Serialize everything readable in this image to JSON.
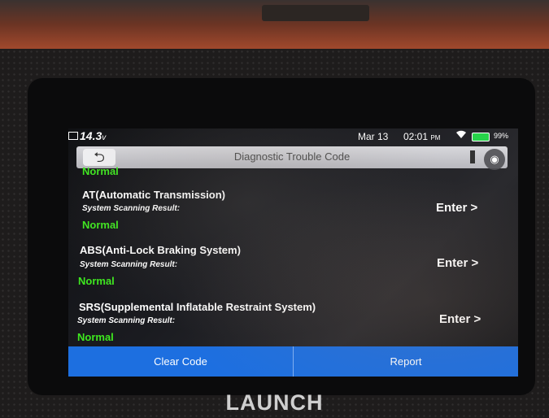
{
  "status_bar": {
    "voltage": "14.3",
    "voltage_unit": "v",
    "date": "Mar 13",
    "time": "02:01",
    "ampm": "PM",
    "battery": "99%"
  },
  "title_bar": {
    "title": "Diagnostic Trouble Code"
  },
  "systems": [
    {
      "name": "",
      "result_label": "",
      "status": "Normal",
      "enter_label": ""
    },
    {
      "name": "AT(Automatic Transmission)",
      "result_label": "System Scanning Result:",
      "status": "Normal",
      "enter_label": "Enter >"
    },
    {
      "name": "ABS(Anti-Lock Braking System)",
      "result_label": "System Scanning Result:",
      "status": "Normal",
      "enter_label": "Enter >"
    },
    {
      "name": "SRS(Supplemental Inflatable Restraint System)",
      "result_label": "System Scanning Result:",
      "status": "Normal",
      "enter_label": "Enter >"
    }
  ],
  "bottom_bar": {
    "clear_code": "Clear Code",
    "report": "Report"
  },
  "brand": "LAUNCH",
  "colors": {
    "status_green": "#3ee81f",
    "button_blue": "#1d6fe0",
    "battery_green": "#27d34a"
  },
  "icons": {
    "back": "back-arrow-icon",
    "wifi": "wifi-icon",
    "battery": "battery-icon",
    "camera": "camera-icon"
  }
}
